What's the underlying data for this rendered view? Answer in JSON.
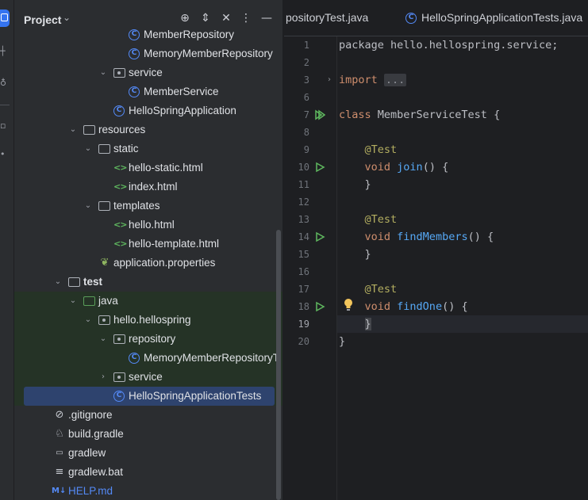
{
  "project_panel": {
    "title": "Project",
    "tree": [
      {
        "label": "MemberRepository",
        "icon": "class-icon"
      },
      {
        "label": "MemoryMemberRepository",
        "icon": "class-icon"
      },
      {
        "label": "service",
        "icon": "package-icon",
        "expanded": true
      },
      {
        "label": "MemberService",
        "icon": "class-icon"
      },
      {
        "label": "HelloSpringApplication",
        "icon": "spring-class-icon"
      },
      {
        "label": "resources",
        "icon": "resources-folder-icon",
        "expanded": true
      },
      {
        "label": "static",
        "icon": "folder-icon",
        "expanded": true
      },
      {
        "label": "hello-static.html",
        "icon": "html-icon"
      },
      {
        "label": "index.html",
        "icon": "html-icon"
      },
      {
        "label": "templates",
        "icon": "folder-icon",
        "expanded": true
      },
      {
        "label": "hello.html",
        "icon": "html-icon"
      },
      {
        "label": "hello-template.html",
        "icon": "html-icon"
      },
      {
        "label": "application.properties",
        "icon": "properties-icon"
      },
      {
        "label": "test",
        "icon": "folder-icon",
        "expanded": true
      },
      {
        "label": "java",
        "icon": "test-sources-folder-icon",
        "expanded": true
      },
      {
        "label": "hello.hellospring",
        "icon": "package-icon",
        "expanded": true
      },
      {
        "label": "repository",
        "icon": "package-icon",
        "expanded": true
      },
      {
        "label": "MemoryMemberRepositoryT",
        "icon": "class-icon"
      },
      {
        "label": "service",
        "icon": "package-icon",
        "expanded": false
      },
      {
        "label": "HelloSpringApplicationTests",
        "icon": "class-icon",
        "selected": true
      },
      {
        "label": ".gitignore",
        "icon": "ignore-file-icon"
      },
      {
        "label": "build.gradle",
        "icon": "gradle-icon"
      },
      {
        "label": "gradlew",
        "icon": "terminal-file-icon"
      },
      {
        "label": "gradlew.bat",
        "icon": "text-file-icon"
      },
      {
        "label": "HELP.md",
        "icon": "markdown-icon"
      }
    ]
  },
  "editor": {
    "tabs": [
      {
        "label": "positoryTest.java"
      },
      {
        "label": "HelloSpringApplicationTests.java"
      }
    ],
    "line_numbers": [
      "1",
      "2",
      "3",
      "6",
      "7",
      "8",
      "9",
      "10",
      "11",
      "12",
      "13",
      "14",
      "15",
      "16",
      "17",
      "18",
      "19",
      "20"
    ],
    "current_line": "19",
    "code": {
      "l1": "package hello.hellospring.service;",
      "l3_kw": "import",
      "l3_fold": "...",
      "l7_kw": "class",
      "l7_rest": " MemberServiceTest {",
      "ann": "@Test",
      "void": "void",
      "join": "join",
      "findMembers": "findMembers",
      "findOne": "findOne",
      "sig_tail": "() {",
      "close_inner": "}",
      "close_outer": "}"
    }
  },
  "colors": {
    "accent": "#3574f0",
    "run_icon": "#5fb85f",
    "keyword": "#cf8e6d",
    "annotation": "#b3ae60",
    "function": "#56a8f5"
  }
}
